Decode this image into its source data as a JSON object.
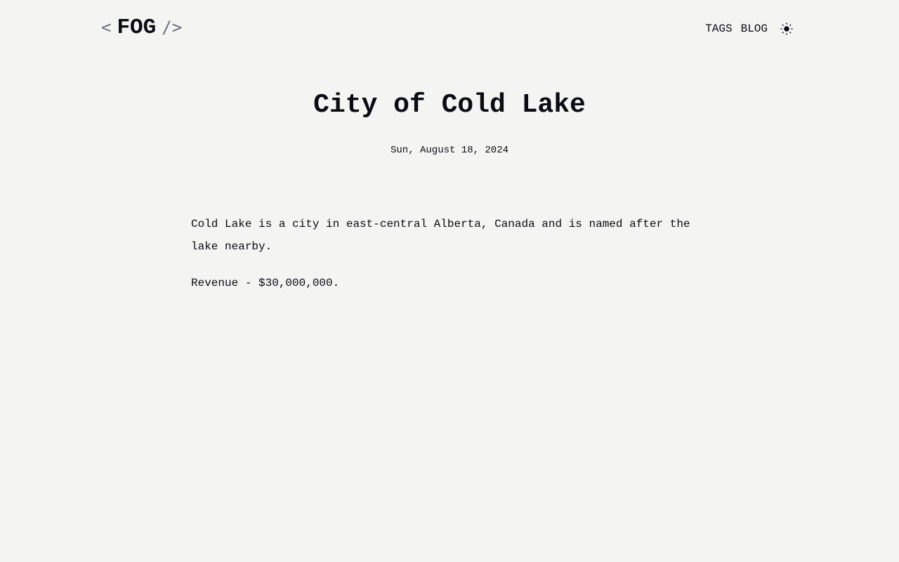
{
  "header": {
    "logo_open": "<",
    "logo_name": "FOG",
    "logo_close": "/>",
    "nav": {
      "tags_label": "TAGS",
      "blog_label": "BLOG"
    },
    "theme_icon": "sun-icon"
  },
  "post": {
    "title": "City of Cold Lake",
    "date": "Sun, August 18, 2024",
    "paragraphs": [
      "Cold Lake is a city in east-central Alberta, Canada and is named after the lake nearby.",
      "Revenue - $30,000,000."
    ]
  },
  "colors": {
    "background": "#f4f4f2",
    "text": "#0b0b14",
    "logo_bracket": "#6b7080"
  }
}
